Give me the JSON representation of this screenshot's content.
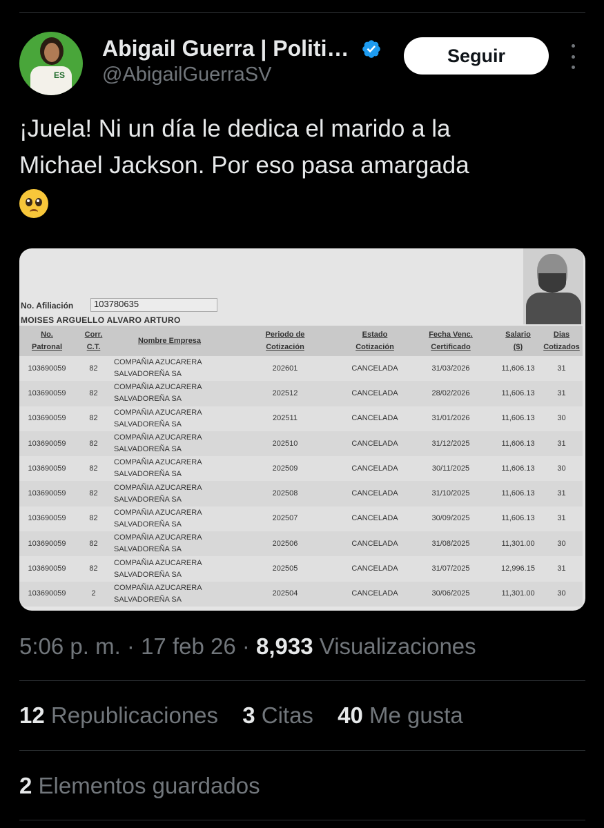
{
  "tweet": {
    "author": {
      "display_name": "Abigail Guerra | Politi…",
      "handle": "@AbigailGuerraSV",
      "avatar_text": "ES"
    },
    "follow_label": "Seguir",
    "text_line1": "¡Juela! Ni un día le dedica el marido a la",
    "text_line2": "Michael Jackson. Por eso pasa amargada",
    "emoji": "pleading-face-emoji"
  },
  "document": {
    "afiliacion_label": "No. Afiliación",
    "afiliacion_value": "103780635",
    "person_name": "MOISES ARGUELLO ALVARO ARTURO",
    "headers": {
      "patronal_1": "No.",
      "patronal_2": "Patronal",
      "corr_1": "Corr.",
      "corr_2": "C.T.",
      "empresa": "Nombre Empresa",
      "periodo_1": "Periodo de",
      "periodo_2": "Cotización",
      "estado_1": "Estado",
      "estado_2": "Cotización",
      "fecha_1": "Fecha Venc.",
      "fecha_2": "Certificado",
      "salario_1": "Salario",
      "salario_2": "($)",
      "dias_1": "Dias",
      "dias_2": "Cotizados"
    },
    "rows": [
      {
        "patronal": "103690059",
        "corr": "82",
        "empresa1": "COMPAÑIA AZUCARERA",
        "empresa2": "SALVADOREÑA SA",
        "periodo": "202601",
        "estado": "CANCELADA",
        "fecha": "31/03/2026",
        "salario": "11,606.13",
        "dias": "31"
      },
      {
        "patronal": "103690059",
        "corr": "82",
        "empresa1": "COMPAÑIA AZUCARERA",
        "empresa2": "SALVADOREÑA SA",
        "periodo": "202512",
        "estado": "CANCELADA",
        "fecha": "28/02/2026",
        "salario": "11,606.13",
        "dias": "31"
      },
      {
        "patronal": "103690059",
        "corr": "82",
        "empresa1": "COMPAÑIA AZUCARERA",
        "empresa2": "SALVADOREÑA SA",
        "periodo": "202511",
        "estado": "CANCELADA",
        "fecha": "31/01/2026",
        "salario": "11,606.13",
        "dias": "30"
      },
      {
        "patronal": "103690059",
        "corr": "82",
        "empresa1": "COMPAÑIA AZUCARERA",
        "empresa2": "SALVADOREÑA SA",
        "periodo": "202510",
        "estado": "CANCELADA",
        "fecha": "31/12/2025",
        "salario": "11,606.13",
        "dias": "31"
      },
      {
        "patronal": "103690059",
        "corr": "82",
        "empresa1": "COMPAÑIA AZUCARERA",
        "empresa2": "SALVADOREÑA SA",
        "periodo": "202509",
        "estado": "CANCELADA",
        "fecha": "30/11/2025",
        "salario": "11,606.13",
        "dias": "30"
      },
      {
        "patronal": "103690059",
        "corr": "82",
        "empresa1": "COMPAÑIA AZUCARERA",
        "empresa2": "SALVADOREÑA SA",
        "periodo": "202508",
        "estado": "CANCELADA",
        "fecha": "31/10/2025",
        "salario": "11,606.13",
        "dias": "31"
      },
      {
        "patronal": "103690059",
        "corr": "82",
        "empresa1": "COMPAÑIA AZUCARERA",
        "empresa2": "SALVADOREÑA SA",
        "periodo": "202507",
        "estado": "CANCELADA",
        "fecha": "30/09/2025",
        "salario": "11,606.13",
        "dias": "31"
      },
      {
        "patronal": "103690059",
        "corr": "82",
        "empresa1": "COMPAÑIA AZUCARERA",
        "empresa2": "SALVADOREÑA SA",
        "periodo": "202506",
        "estado": "CANCELADA",
        "fecha": "31/08/2025",
        "salario": "11,301.00",
        "dias": "30"
      },
      {
        "patronal": "103690059",
        "corr": "82",
        "empresa1": "COMPAÑIA AZUCARERA",
        "empresa2": "SALVADOREÑA SA",
        "periodo": "202505",
        "estado": "CANCELADA",
        "fecha": "31/07/2025",
        "salario": "12,996.15",
        "dias": "31"
      },
      {
        "patronal": "103690059",
        "corr": "2",
        "empresa1": "COMPAÑIA AZUCARERA",
        "empresa2": "SALVADOREÑA SA",
        "periodo": "202504",
        "estado": "CANCELADA",
        "fecha": "30/06/2025",
        "salario": "11,301.00",
        "dias": "30"
      }
    ]
  },
  "meta": {
    "time": "5:06 p. m. · 17 feb 26 · ",
    "views_count": "8,933",
    "views_label": " Visualizaciones"
  },
  "stats": {
    "reposts_count": "12",
    "reposts_label": " Republicaciones",
    "quotes_count": "3",
    "quotes_label": " Citas",
    "likes_count": "40",
    "likes_label": " Me gusta",
    "bookmarks_count": "2",
    "bookmarks_label": " Elementos guardados"
  },
  "colors": {
    "background": "#000000",
    "text_primary": "#e7e9ea",
    "text_secondary": "#71767b",
    "verified_blue": "#1d9bf0",
    "divider": "#2f3336"
  }
}
